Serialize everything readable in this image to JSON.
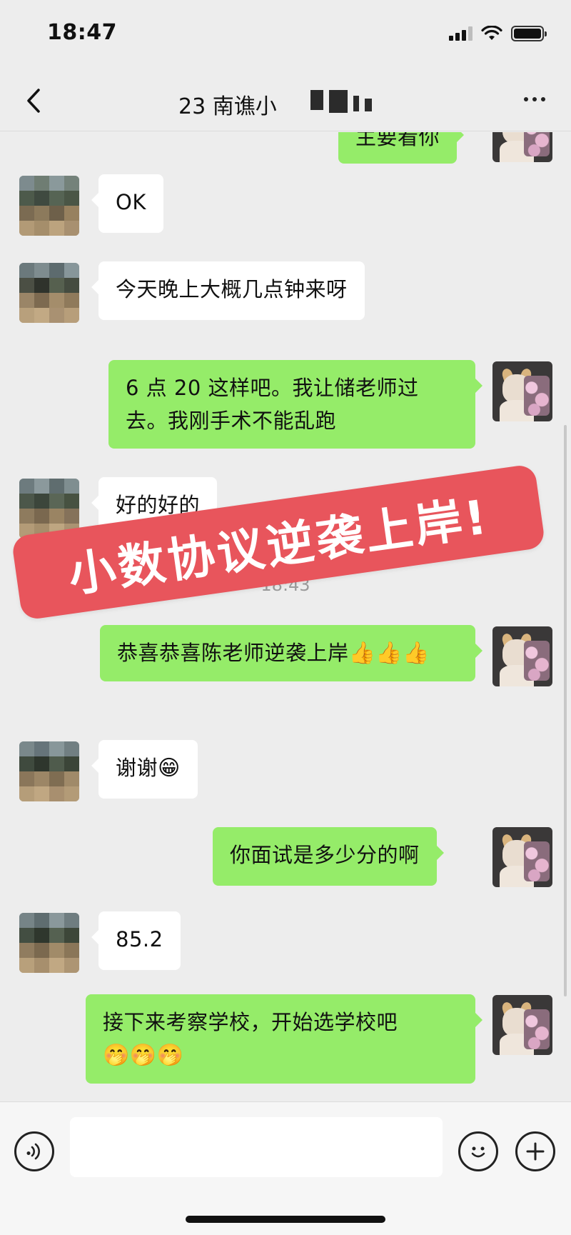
{
  "status_bar": {
    "time": "18:47",
    "icons": [
      "signal-icon",
      "wifi-icon",
      "battery-icon"
    ]
  },
  "header": {
    "back_icon": "chevron-left-icon",
    "title": "23 南谯小",
    "more_icon": "more-dots-icon"
  },
  "messages": [
    {
      "sender": "self",
      "text": "主要看你"
    },
    {
      "sender": "other",
      "text": "OK"
    },
    {
      "sender": "other",
      "text": "今天晚上大概几点钟来呀"
    },
    {
      "sender": "self",
      "text": "6 点 20 这样吧。我让储老师过去。我刚手术不能乱跑"
    },
    {
      "sender": "other",
      "text": "好的好的"
    },
    {
      "sender": "self",
      "text": "恭喜恭喜陈老师逆袭上岸",
      "emoji": "👍👍👍"
    },
    {
      "sender": "other",
      "text": "谢谢",
      "emoji": "😁"
    },
    {
      "sender": "self",
      "text": "你面试是多少分的啊"
    },
    {
      "sender": "other",
      "text": "85.2"
    },
    {
      "sender": "self",
      "text": "接下来考察学校，开始选学校吧",
      "emoji": "🤭🤭🤭"
    }
  ],
  "timestamp": "18:43",
  "overlay": {
    "text": "小数协议逆袭上岸!",
    "color": "#e8555c"
  },
  "input_bar": {
    "voice_icon": "voice-icon",
    "emoji_icon": "emoji-icon",
    "plus_icon": "plus-icon",
    "placeholder": ""
  },
  "colors": {
    "background": "#ededed",
    "bubble_out": "#95ec69",
    "bubble_in": "#ffffff"
  }
}
